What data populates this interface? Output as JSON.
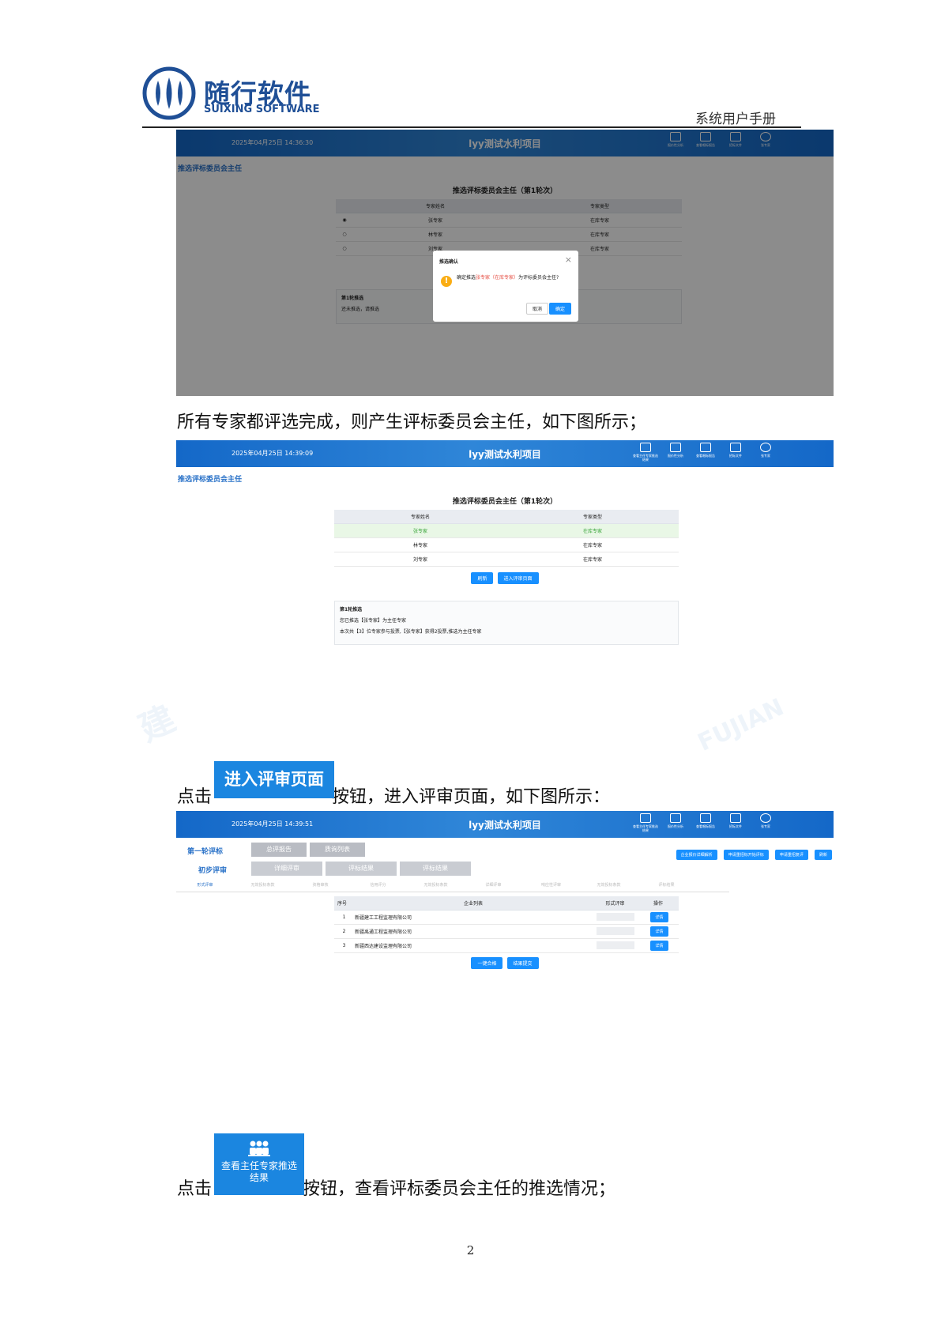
{
  "page_header": {
    "logo_cn": "随行软件",
    "logo_en": "SUIXING SOFTWARE",
    "doc_tag": "系统用户手册"
  },
  "topbar_icons": [
    "查看主任专家推选结果",
    "报价性分析",
    "查看唱标报告",
    "招标文件",
    "张专家"
  ],
  "shot1": {
    "datetime": "2025年04月25日 14:36:30",
    "project": "lyy测试水利项目",
    "breadcrumb": "推选评标委员会主任",
    "table_title": "推选评标委员会主任（第1轮次）",
    "headers": [
      "专家姓名",
      "专家类型"
    ],
    "rows": [
      {
        "name": "张专家",
        "type": "在库专家"
      },
      {
        "name": "林专家",
        "type": "在库专家"
      },
      {
        "name": "刘专家",
        "type": "在库专家"
      }
    ],
    "note_title": "第1轮推选",
    "note_line": "还未推选，请推选",
    "dialog": {
      "title": "推选确认",
      "text_pre": "确定推选",
      "text_name": "张专家（在库专家）",
      "text_post": "为评标委员会主任?",
      "cancel": "取消",
      "ok": "确定"
    }
  },
  "para1": "所有专家都评选完成，则产生评标委员会主任，如下图所示；",
  "shot2": {
    "datetime": "2025年04月25日 14:39:09",
    "project": "lyy测试水利项目",
    "breadcrumb": "推选评标委员会主任",
    "table_title": "推选评标委员会主任（第1轮次）",
    "headers": [
      "专家姓名",
      "专家类型"
    ],
    "rows": [
      {
        "name": "张专家",
        "type": "在库专家"
      },
      {
        "name": "林专家",
        "type": "在库专家"
      },
      {
        "name": "刘专家",
        "type": "在库专家"
      }
    ],
    "btn_refresh": "刷新",
    "btn_enter": "进入评审页面",
    "note_title": "第1轮推选",
    "note_line1": "您已推选【张专家】为主任专家",
    "note_line2": "本次共【3】位专家参与投票,【张专家】获得2投票,推选为主任专家"
  },
  "para2": {
    "pre": "点击",
    "button": "进入评审页面",
    "post": "按钮，进入评审页面，如下图所示："
  },
  "shot3": {
    "datetime": "2025年04月25日 14:39:51",
    "project": "lyy测试水利项目",
    "round_label": "第一轮评标",
    "top_tabs": [
      "总评报告",
      "质询列表"
    ],
    "right_buttons": [
      "企业报价详细解析",
      "申请重招标开始评标",
      "申请重招复评",
      "刷新"
    ],
    "stage_label": "初步评审",
    "stage_tabs": [
      "详细评审",
      "评标结果",
      "评标结果"
    ],
    "sub_label": "形式评审",
    "sub_tabs": [
      "无效投标条款",
      "资格审核",
      "信用评分",
      "无效投标条款",
      "详细评审",
      "响应性评审",
      "无效投标条款",
      "评标结果"
    ],
    "headers": [
      "序号",
      "企业列表",
      "形式评审",
      "操作"
    ],
    "rows": [
      {
        "no": "1",
        "name": "新疆建工工程监理有限公司",
        "op": "详情"
      },
      {
        "no": "2",
        "name": "新疆禹通工程监理有限公司",
        "op": "详情"
      },
      {
        "no": "3",
        "name": "新疆西达建设监理有限公司",
        "op": "详情"
      }
    ],
    "btn_one": "一键合格",
    "btn_submit": "结果提交"
  },
  "para3": {
    "pre": "点击",
    "button": "查看主任专家推选结果",
    "post": "按钮，查看评标委员会主任的推选情况；"
  },
  "page_number": "2",
  "colors": {
    "brand": "#1f4f96",
    "topbar": "#1a73d0",
    "button": "#1890ff",
    "highlight_row": "#e9f7e6",
    "highlight_text": "#3aa53a"
  }
}
